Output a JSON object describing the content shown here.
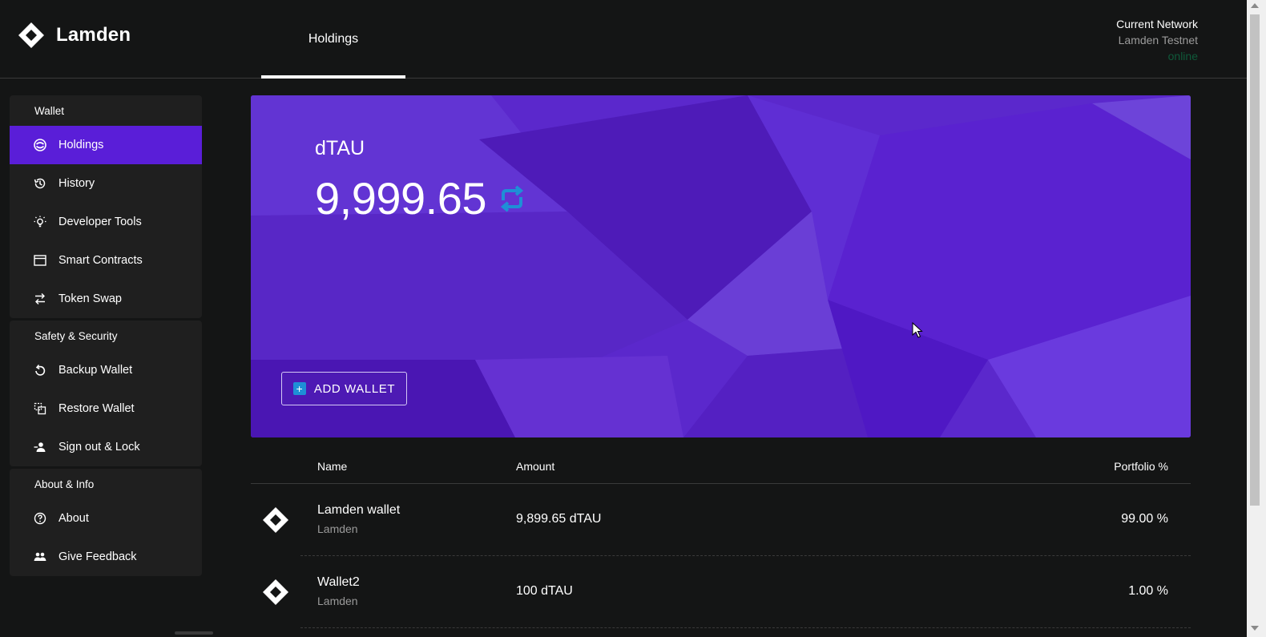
{
  "app": {
    "name": "Lamden"
  },
  "header": {
    "tab_label": "Holdings",
    "network_title": "Current Network",
    "network_name": "Lamden Testnet",
    "network_status": "online"
  },
  "sidebar": {
    "groups": [
      {
        "title": "Wallet",
        "items": [
          {
            "label": "Holdings",
            "icon": "holdings-icon",
            "active": true
          },
          {
            "label": "History",
            "icon": "history-icon"
          },
          {
            "label": "Developer Tools",
            "icon": "lightbulb-icon"
          },
          {
            "label": "Smart Contracts",
            "icon": "window-icon"
          },
          {
            "label": "Token Swap",
            "icon": "swap-icon"
          }
        ]
      },
      {
        "title": "Safety & Security",
        "items": [
          {
            "label": "Backup Wallet",
            "icon": "backup-icon"
          },
          {
            "label": "Restore Wallet",
            "icon": "restore-icon"
          },
          {
            "label": "Sign out & Lock",
            "icon": "sign-out-icon"
          }
        ]
      },
      {
        "title": "About & Info",
        "items": [
          {
            "label": "About",
            "icon": "help-circle-icon"
          },
          {
            "label": "Give Feedback",
            "icon": "people-icon"
          }
        ]
      }
    ]
  },
  "banner": {
    "token": "dTAU",
    "balance": "9,999.65",
    "add_wallet_label": "ADD WALLET"
  },
  "table": {
    "headers": {
      "name": "Name",
      "amount": "Amount",
      "portfolio": "Portfolio %"
    },
    "rows": [
      {
        "name": "Lamden wallet",
        "subtitle": "Lamden",
        "amount": "9,899.65 dTAU",
        "portfolio": "99.00 %"
      },
      {
        "name": "Wallet2",
        "subtitle": "Lamden",
        "amount": "100 dTAU",
        "portfolio": "1.00 %"
      }
    ]
  },
  "colors": {
    "accent": "#5a1ed8",
    "banner": "#5b28cc",
    "refresh": "#1e8fd6",
    "background": "#141515",
    "sidebar": "#1f1f1f"
  }
}
